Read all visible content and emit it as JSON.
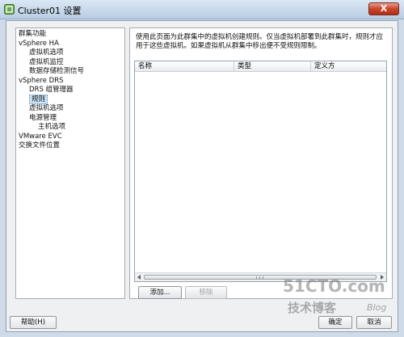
{
  "window": {
    "title": "Cluster01 设置",
    "close_label": "X",
    "colors": {
      "titlebar": "#c9d9ea",
      "close": "#c8452d",
      "selection": "#cce4f7"
    }
  },
  "nav": {
    "items": [
      {
        "label": "群集功能",
        "level": 1
      },
      {
        "label": "vSphere HA",
        "level": 1
      },
      {
        "label": "虚拟机选项",
        "level": 2
      },
      {
        "label": "虚拟机监控",
        "level": 2
      },
      {
        "label": "数据存储检测信号",
        "level": 2
      },
      {
        "label": "vSphere DRS",
        "level": 1
      },
      {
        "label": "DRS 组管理器",
        "level": 2
      },
      {
        "label": "规则",
        "level": 2,
        "selected": true
      },
      {
        "label": "虚拟机选项",
        "level": 2
      },
      {
        "label": "电源管理",
        "level": 2
      },
      {
        "label": "主机选项",
        "level": 3
      },
      {
        "label": "VMware EVC",
        "level": 1
      },
      {
        "label": "交换文件位置",
        "level": 1
      }
    ]
  },
  "content": {
    "description": "使用此页面为此群集中的虚拟机创建规则。仅当虚拟机部署到此群集时，规则才应用于这些虚拟机。如果虚拟机从群集中移出便不受规则限制。",
    "table": {
      "columns": [
        "名称",
        "类型",
        "定义方"
      ],
      "rows": []
    },
    "add_label": "添加...",
    "remove_label": "移除"
  },
  "footer": {
    "help_label": "帮助(H)",
    "ok_label": "确定",
    "cancel_label": "取消"
  },
  "watermark": {
    "site": "51CTO.com",
    "tagline": "技术博客",
    "blog": "Blog"
  }
}
